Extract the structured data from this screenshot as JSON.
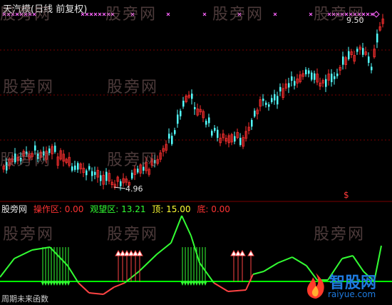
{
  "window": {
    "title": "天汽模(日线 前复权)"
  },
  "watermarks": [
    "股旁网",
    "股旁网",
    "股旁网",
    "股旁网",
    "股旁网",
    "股旁网",
    "股旁网",
    "股旁网",
    "股旁网",
    "股旁网",
    "股旁网"
  ],
  "price_labels": {
    "high": "9.50",
    "low": "4.96"
  },
  "signal_marker": "$",
  "indicator_panel": {
    "name": "股旁网",
    "op_label": "操作区: 0.00",
    "watch_label": "观望区: 13.21",
    "top_label": "顶: 15.00",
    "bottom_label": "底: 0.00"
  },
  "footer_text": "周期未来函数",
  "logo": {
    "name": "智股网",
    "url": "raiyue.com"
  },
  "colors": {
    "background": "#000000",
    "up_candle": "#ff3030",
    "down_candle": "#54ffff",
    "grid": "#7a0000",
    "indicator_line": "#33ff33",
    "zero_line": "#00ff00",
    "buy_arrow": "#33ff33",
    "sell_arrow": "#ff4444",
    "top_marker": "#ff66ff",
    "op_text": "#ff3333",
    "watch_text": "#33ff33",
    "top_text": "#ffff33",
    "bottom_text": "#ff3333"
  },
  "icons": {
    "top_signal": "magenta-cross-icon",
    "buy_signal": "green-arrow-down-icon",
    "sell_signal": "red-arrow-up-icon"
  }
}
